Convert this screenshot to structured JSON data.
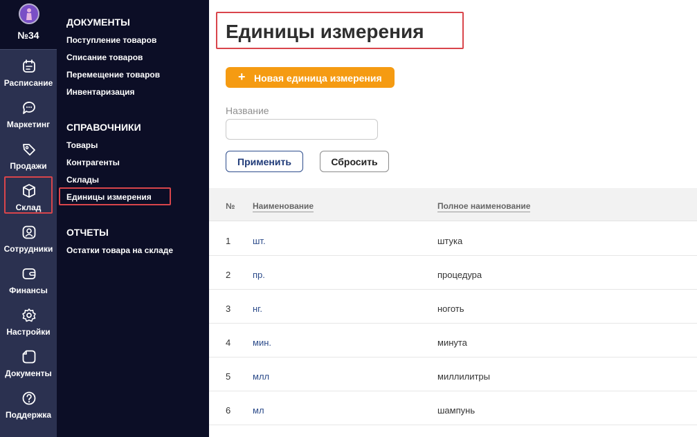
{
  "sidebar": {
    "salon_number": "№34",
    "items": [
      {
        "label": "Расписание",
        "icon": "calendar-icon"
      },
      {
        "label": "Маркетинг",
        "icon": "chat-icon"
      },
      {
        "label": "Продажи",
        "icon": "tag-icon"
      },
      {
        "label": "Склад",
        "icon": "box-icon",
        "active": true
      },
      {
        "label": "Сотрудники",
        "icon": "user-icon"
      },
      {
        "label": "Финансы",
        "icon": "wallet-icon"
      },
      {
        "label": "Настройки",
        "icon": "gear-icon"
      },
      {
        "label": "Документы",
        "icon": "document-icon"
      },
      {
        "label": "Поддержка",
        "icon": "help-icon"
      }
    ]
  },
  "submenu": {
    "documents": {
      "title": "ДОКУМЕНТЫ",
      "links": [
        "Поступление товаров",
        "Списание товаров",
        "Перемещение товаров",
        "Инвентаризация"
      ]
    },
    "references": {
      "title": "СПРАВОЧНИКИ",
      "links": [
        "Товары",
        "Контрагенты",
        "Склады",
        "Единицы измерения"
      ]
    },
    "reports": {
      "title": "ОТЧЕТЫ",
      "links": [
        "Остатки товара на складе"
      ]
    }
  },
  "main": {
    "title": "Единицы измерения",
    "new_button": {
      "plus": "+",
      "label": "Новая единица измерения"
    },
    "filter": {
      "name_label": "Название",
      "name_value": "",
      "apply": "Применить",
      "reset": "Сбросить"
    },
    "table": {
      "headers": {
        "num": "№",
        "name": "Наименование",
        "full": "Полное наименование"
      },
      "rows": [
        {
          "num": "1",
          "name": "шт.",
          "full": "штука"
        },
        {
          "num": "2",
          "name": "пр.",
          "full": "процедура"
        },
        {
          "num": "3",
          "name": "нг.",
          "full": "ноготь"
        },
        {
          "num": "4",
          "name": "мин.",
          "full": "минута"
        },
        {
          "num": "5",
          "name": "млл",
          "full": "миллилитры"
        },
        {
          "num": "6",
          "name": "мл",
          "full": "шампунь"
        }
      ]
    }
  },
  "colors": {
    "accent": "#f59b12",
    "highlight": "#d9454b",
    "rail": "#2b3150",
    "panel": "#0c0e26",
    "link": "#2c4b8a"
  }
}
